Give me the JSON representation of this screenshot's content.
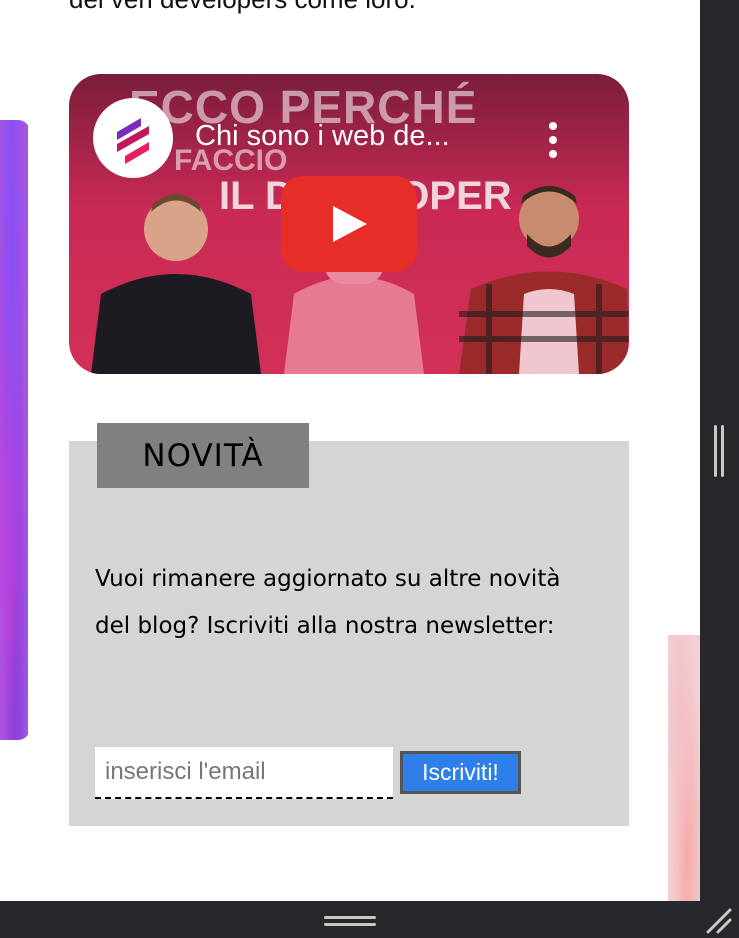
{
  "article": {
    "top_text": "dei veri developers come loro."
  },
  "video": {
    "title": "Chi sono i web de...",
    "overlay_line1": "ECCO PERCHÉ",
    "overlay_line2": "FACCIO",
    "overlay_line3": "IL DEVELOPER",
    "icons": [
      "channel-logo-icon",
      "more-vert-icon",
      "youtube-play-icon"
    ]
  },
  "newsletter": {
    "heading": "NOVITÀ",
    "description": "Vuoi rimanere aggiornato su altre novità del blog? Iscriviti alla nostra newsletter:",
    "email_placeholder": "inserisci l'email",
    "email_value": "",
    "subscribe_label": "Iscriviti!"
  },
  "colors": {
    "play_button": "#e62d27",
    "subscribe_button": "#2f7fe8",
    "news_box": "#d5d6d4",
    "news_tag": "#808080",
    "chrome": "#27282b"
  }
}
